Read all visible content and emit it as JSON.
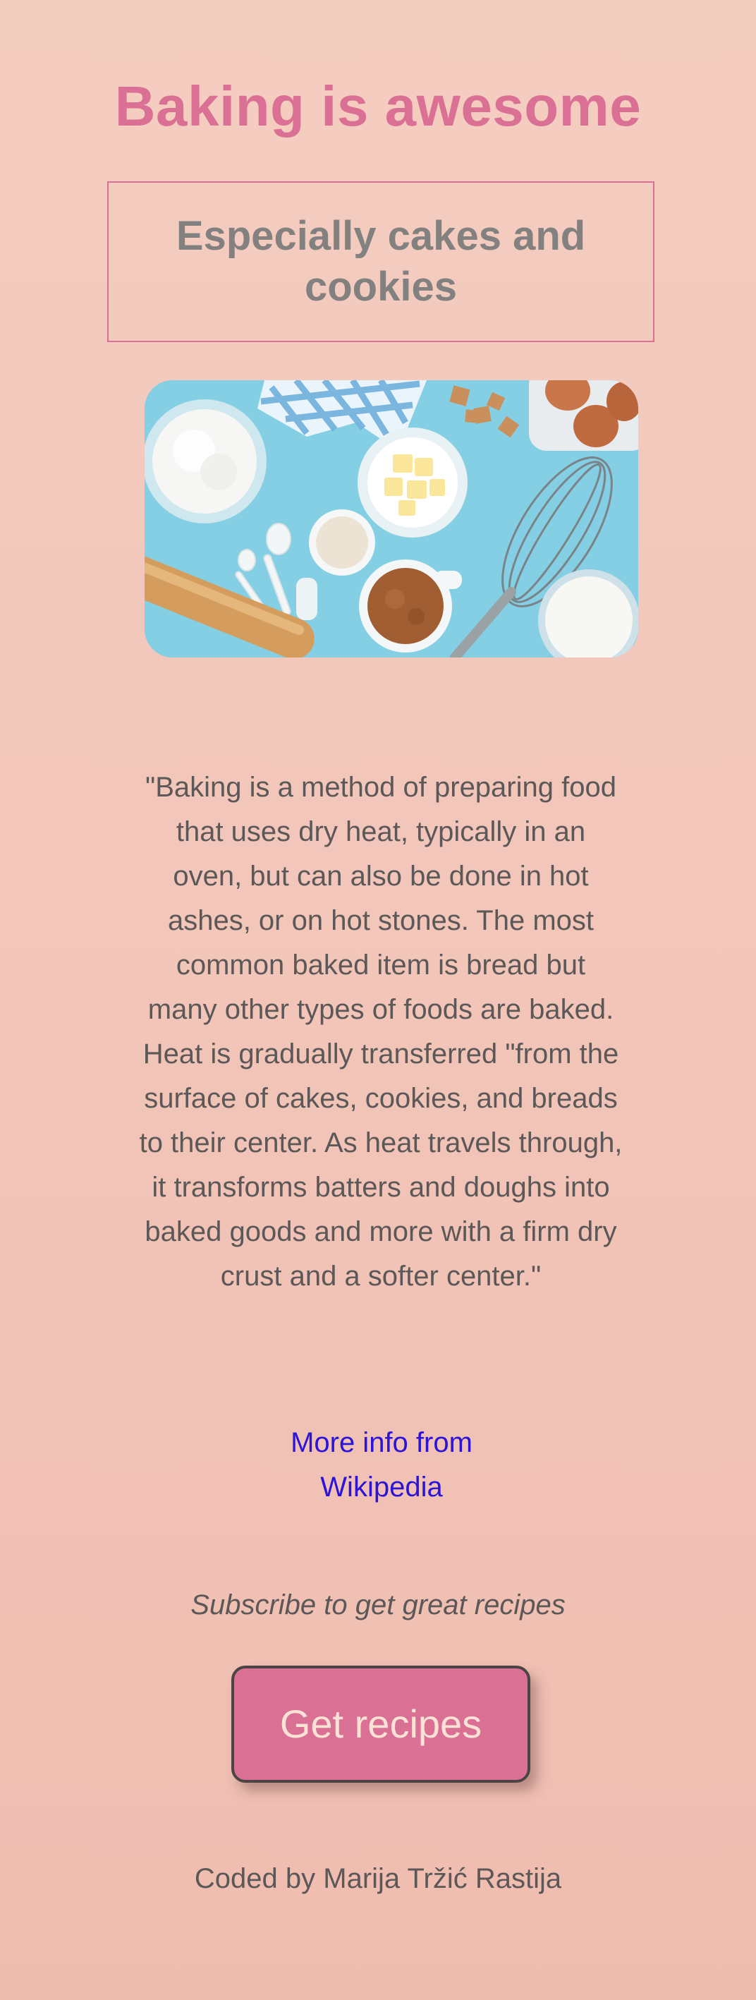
{
  "header": {
    "title": "Baking is awesome",
    "subtitle": "Especially cakes and cookies"
  },
  "hero_image": {
    "alt": "",
    "background_color": "#82cde3",
    "items": [
      "bowl-of-flour",
      "checkered-napkin",
      "sugar-cubes",
      "eggs-in-carton",
      "bowl-of-butter",
      "measuring-spoons",
      "measuring-cup",
      "cup-of-brown-sugar",
      "whisk",
      "glass-of-milk",
      "rolling-pin"
    ]
  },
  "quote": {
    "text": "\"Baking is a method of preparing food that uses dry heat, typically in an oven, but can also be done in hot ashes, or on hot stones. The most common baked item is bread but many other types of foods are baked. Heat is gradually transferred \"from the surface of cakes, cookies, and breads to their center. As heat travels through, it transforms batters and doughs into baked goods and more with a firm dry crust and a softer center.\""
  },
  "link": {
    "text": "More info from Wikipedia"
  },
  "subscribe": {
    "prompt": "Subscribe to get great recipes",
    "button_label": "Get recipes"
  },
  "footer": {
    "credit": "Coded by Marija Tržić Rastija"
  },
  "colors": {
    "accent": "#db7095",
    "background_top": "#f4cdc1",
    "background_bottom": "#efbdb0",
    "link": "#2b14d8",
    "subtitle": "#838080"
  }
}
